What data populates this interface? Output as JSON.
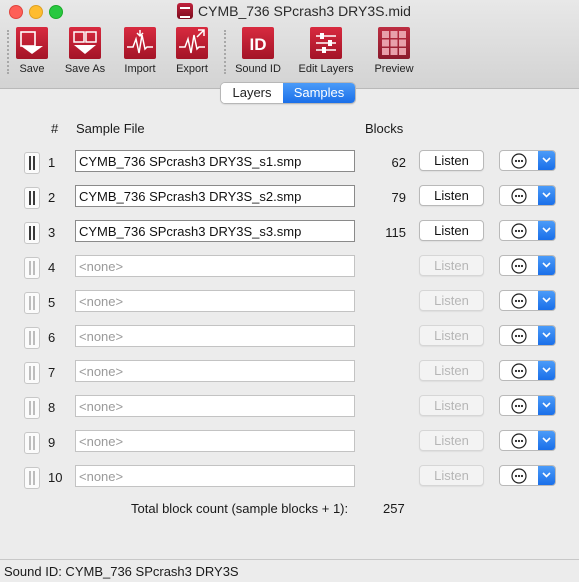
{
  "window": {
    "title": "CYMB_736 SPcrash3 DRY3S.mid"
  },
  "toolbar": {
    "items": [
      {
        "label": "Save",
        "icon": "save-icon"
      },
      {
        "label": "Save As",
        "icon": "save-as-icon"
      },
      {
        "label": "Import",
        "icon": "import-icon"
      },
      {
        "label": "Export",
        "icon": "export-icon"
      },
      {
        "label": "Sound ID",
        "icon": "sound-id-icon"
      },
      {
        "label": "Edit Layers",
        "icon": "edit-layers-icon"
      },
      {
        "label": "Preview",
        "icon": "preview-icon"
      }
    ]
  },
  "tabs": [
    {
      "label": "Layers",
      "selected": false
    },
    {
      "label": "Samples",
      "selected": true
    }
  ],
  "table": {
    "headers": {
      "num": "#",
      "file": "Sample File",
      "blocks": "Blocks"
    },
    "listen_label": "Listen",
    "placeholder": "<none>",
    "rows": [
      {
        "num": "1",
        "file": "CYMB_736 SPcrash3 DRY3S_s1.smp",
        "blocks": "62"
      },
      {
        "num": "2",
        "file": "CYMB_736 SPcrash3 DRY3S_s2.smp",
        "blocks": "79"
      },
      {
        "num": "3",
        "file": "CYMB_736 SPcrash3 DRY3S_s3.smp",
        "blocks": "115"
      },
      {
        "num": "4",
        "file": "",
        "blocks": ""
      },
      {
        "num": "5",
        "file": "",
        "blocks": ""
      },
      {
        "num": "6",
        "file": "",
        "blocks": ""
      },
      {
        "num": "7",
        "file": "",
        "blocks": ""
      },
      {
        "num": "8",
        "file": "",
        "blocks": ""
      },
      {
        "num": "9",
        "file": "",
        "blocks": ""
      },
      {
        "num": "10",
        "file": "",
        "blocks": ""
      }
    ]
  },
  "total": {
    "label": "Total block count (sample blocks + 1):",
    "value": "257"
  },
  "status": {
    "text": "Sound ID: CYMB_736 SPcrash3 DRY3S"
  },
  "colors": {
    "accent": "#1a6fe9",
    "toolbar_icon": "#c41e36"
  }
}
